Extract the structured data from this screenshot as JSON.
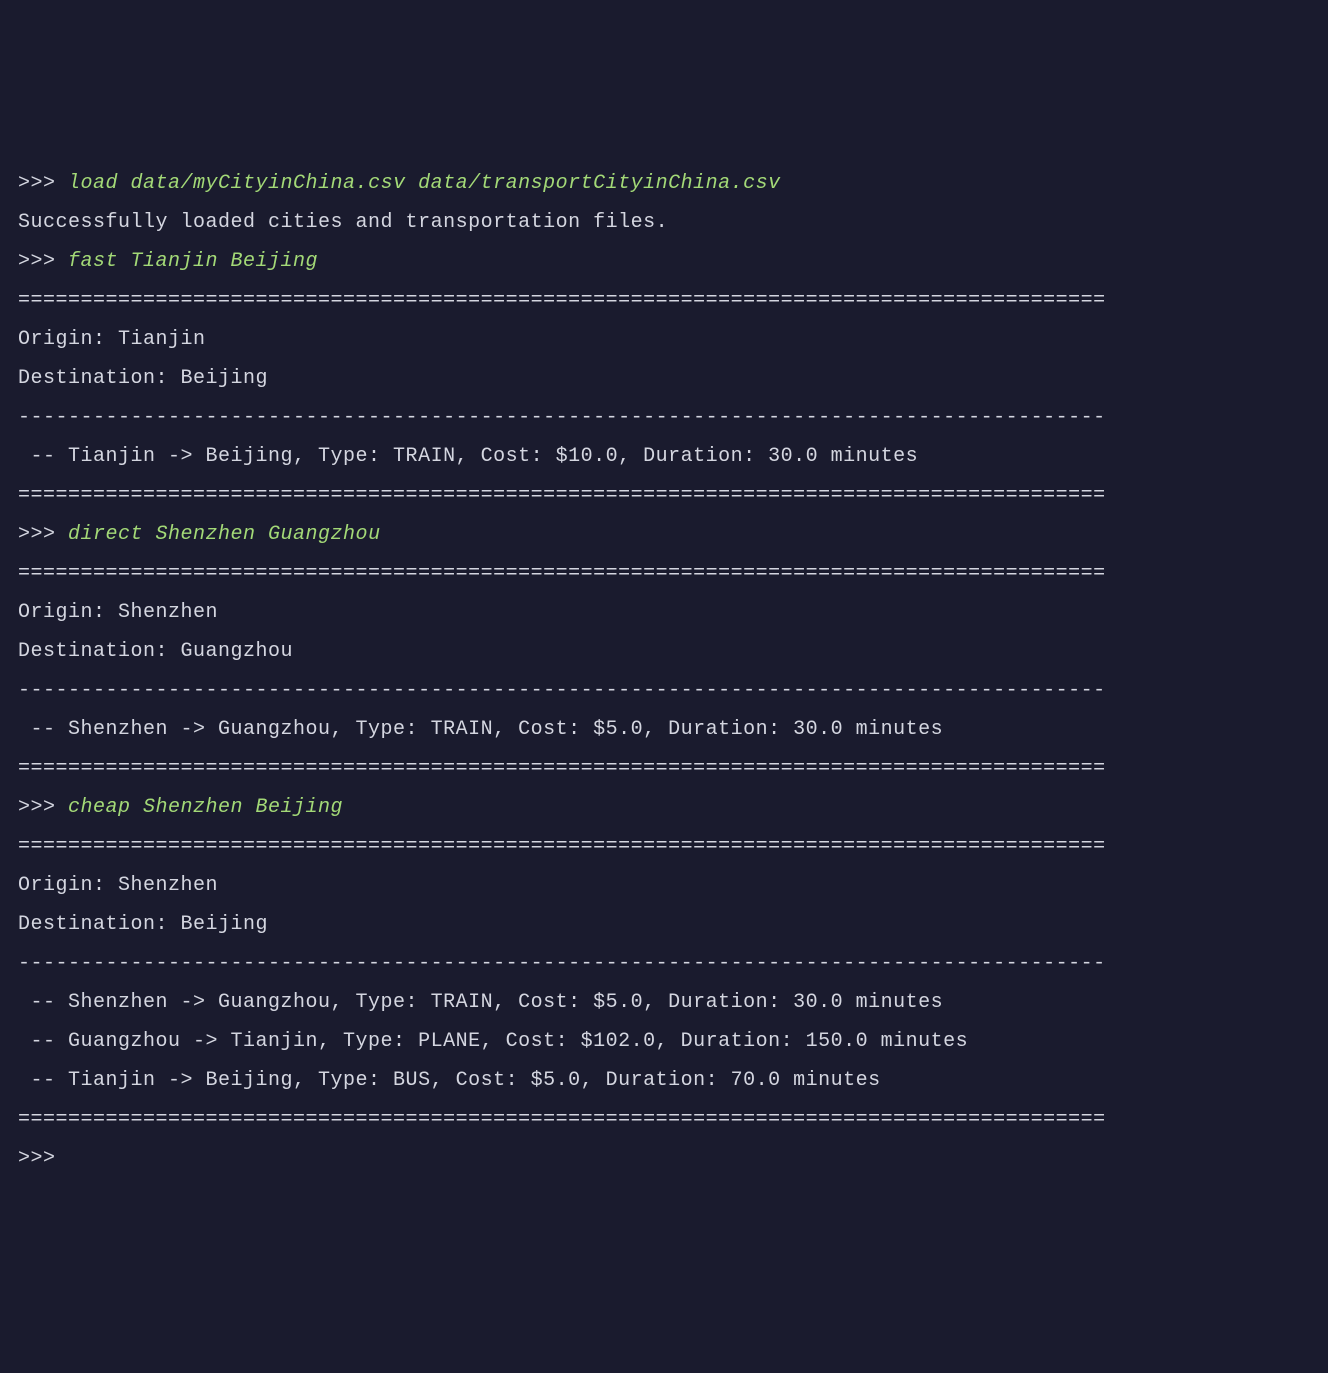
{
  "prompt": ">>> ",
  "lines": {
    "l1_cmd": "load data/myCityinChina.csv data/transportCityinChina.csv",
    "l2": "Successfully loaded cities and transportation files.",
    "l3_cmd": "fast Tianjin Beijing",
    "sep_eq": "=======================================================================================",
    "l5": "Origin: Tianjin",
    "l6": "Destination: Beijing",
    "sep_dash": "---------------------------------------------------------------------------------------",
    "l8": " -- Tianjin -> Beijing, Type: TRAIN, Cost: $10.0, Duration: 30.0 minutes",
    "l10_cmd": "direct Shenzhen Guangzhou",
    "l12": "Origin: Shenzhen",
    "l13": "Destination: Guangzhou",
    "l15": " -- Shenzhen -> Guangzhou, Type: TRAIN, Cost: $5.0, Duration: 30.0 minutes",
    "l17_cmd": "cheap Shenzhen Beijing",
    "l19": "Origin: Shenzhen",
    "l20": "Destination: Beijing",
    "l22": " -- Shenzhen -> Guangzhou, Type: TRAIN, Cost: $5.0, Duration: 30.0 minutes",
    "l23": " -- Guangzhou -> Tianjin, Type: PLANE, Cost: $102.0, Duration: 150.0 minutes",
    "l24": " -- Tianjin -> Beijing, Type: BUS, Cost: $5.0, Duration: 70.0 minutes",
    "empty": ""
  }
}
